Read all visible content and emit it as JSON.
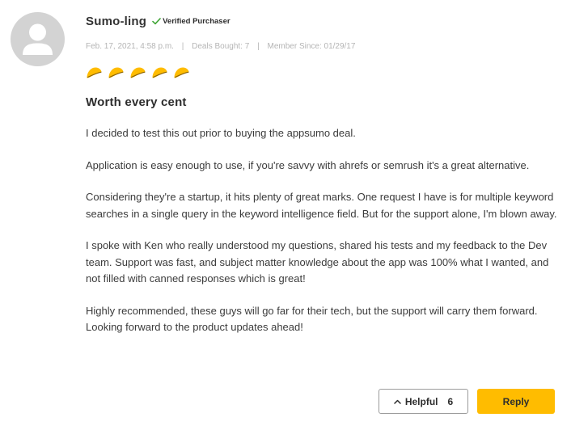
{
  "review": {
    "username": "Sumo-ling",
    "verified_label": "Verified Purchaser",
    "meta": {
      "date": "Feb. 17, 2021, 4:58 p.m.",
      "deals_bought": "Deals Bought: 7",
      "member_since": "Member Since: 01/29/17",
      "separator": "|"
    },
    "rating": {
      "value": 5,
      "max": 5,
      "icon": "taco-icon"
    },
    "title": "Worth every cent",
    "paragraphs": [
      "I decided to test this out prior to buying the appsumo deal.",
      "Application is easy enough to use, if you're savvy with ahrefs or semrush it's a great alternative.",
      "Considering they're a startup, it hits plenty of great marks. One request I have is for multiple keyword searches in a single query in the keyword intelligence field. But for the support alone, I'm blown away.",
      "I spoke with Ken who really understood my questions, shared his tests and my feedback to the Dev team. Support was fast, and subject matter knowledge about the app was 100% what I wanted, and not filled with canned responses which is great!",
      "Highly recommended, these guys will go far for their tech, but the support will carry them forward. Looking forward to the product updates ahead!"
    ]
  },
  "actions": {
    "helpful_label": "Helpful",
    "helpful_count": "6",
    "reply_label": "Reply"
  },
  "colors": {
    "accent": "#ffbc00",
    "verified_check": "#3fa535",
    "meta_text": "#b5b5b5",
    "avatar_bg": "#d3d3d3"
  }
}
